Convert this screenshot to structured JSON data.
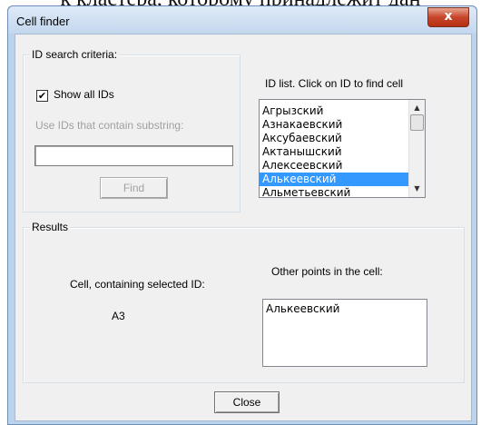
{
  "background_text": "к кластера, которому принадлежит дан",
  "window": {
    "title": "Cell finder",
    "close_glyph": "x"
  },
  "id_search": {
    "legend": "ID search criteria:",
    "show_all_label": "Show all IDs",
    "show_all_checked": true,
    "show_all_mark": "✔",
    "substring_label": "Use IDs that contain substring:",
    "substring_value": "",
    "find_label": "Find"
  },
  "id_list": {
    "header": "ID list.  Click on ID to find cell",
    "items": [
      "Агрызский",
      "Азнакаевский",
      "Аксубаевский",
      "Актанышский",
      "Алексеевский",
      "Алькеевский",
      "Альметьевский"
    ],
    "selected": "Алькеевский",
    "scroll_up_glyph": "▲",
    "scroll_down_glyph": "▼"
  },
  "results": {
    "legend": "Results",
    "cell_label": "Cell, containing selected ID:",
    "cell_value": "A3",
    "other_points_label": "Other points in the cell:",
    "other_points": [
      "Алькеевский"
    ]
  },
  "footer": {
    "close_label": "Close"
  }
}
